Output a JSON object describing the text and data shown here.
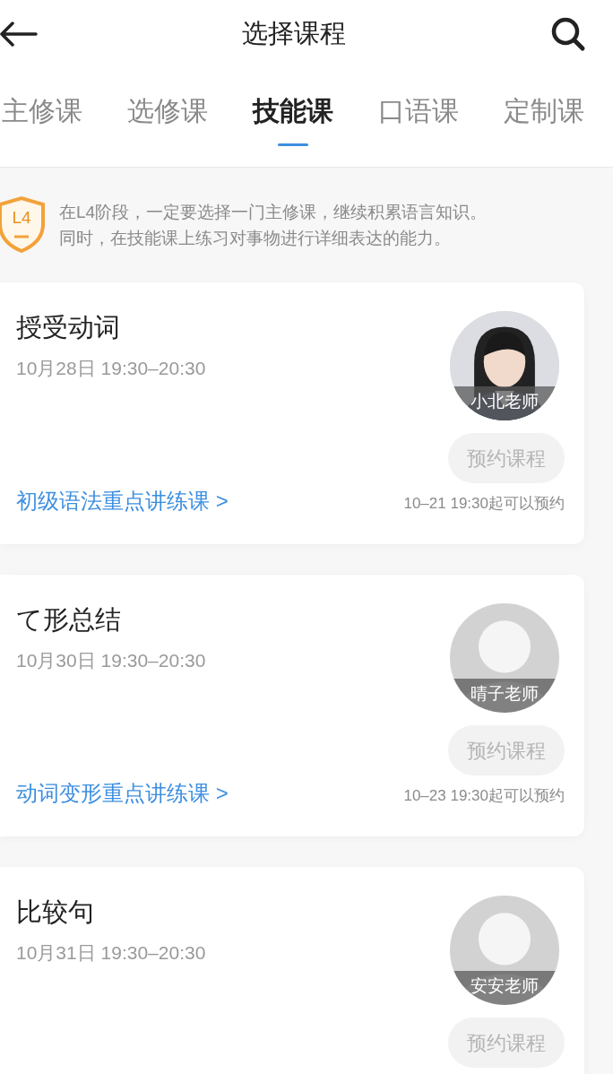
{
  "header": {
    "title": "选择课程"
  },
  "tabs": [
    {
      "label": "主修课",
      "selected": false
    },
    {
      "label": "选修课",
      "selected": false
    },
    {
      "label": "技能课",
      "selected": true
    },
    {
      "label": "口语课",
      "selected": false
    },
    {
      "label": "定制课",
      "selected": false
    }
  ],
  "notice": {
    "badge": "L4",
    "lines": [
      "在L4阶段，一定要选择一门主修课，继续积累语言知识。",
      "同时，在技能课上练习对事物进行详细表达的能力。"
    ]
  },
  "courses": [
    {
      "title": "授受动词",
      "time": "10月28日 19:30–20:30",
      "teacher": "小北老师",
      "button": "预约课程",
      "disabled": true,
      "series": "初级语法重点讲练课 >",
      "note": "10–21 19:30起可以预约"
    },
    {
      "title": "て形总结",
      "time": "10月30日 19:30–20:30",
      "teacher": "晴子老师",
      "avatar": {
        "kind": "default"
      },
      "button": "预约课程",
      "disabled": true,
      "series": "动词变形重点讲练课 >",
      "note": "10–23 19:30起可以预约"
    },
    {
      "title": "比较句",
      "time": "10月31日 19:30–20:30",
      "teacher": "安安老师",
      "avatar": {
        "kind": "default"
      },
      "button": "预约课程",
      "disabled": true
    }
  ]
}
